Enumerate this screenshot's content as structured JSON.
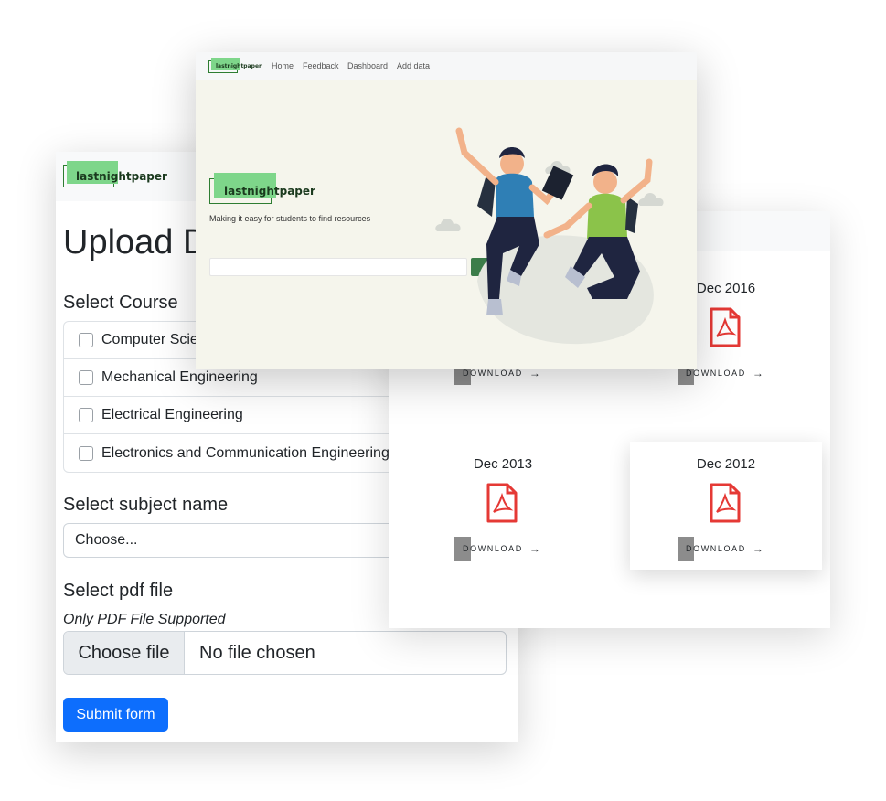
{
  "upload_window": {
    "logo_text": "lastnightpaper",
    "title": "Upload Data",
    "course_heading": "Select Course",
    "courses": [
      "Computer Science",
      "Mechanical Engineering",
      "Electrical Engineering",
      "Electronics and Communication Engineering"
    ],
    "subject_heading": "Select subject name",
    "subject_placeholder": "Choose...",
    "pdf_heading": "Select pdf file",
    "pdf_hint": "Only PDF File Supported",
    "file_button": "Choose file",
    "file_status": "No file chosen",
    "submit_label": "Submit form",
    "colors": {
      "primary": "#0d6efd",
      "logo": "#7ed68a"
    }
  },
  "home_window": {
    "logo_text": "lastnightpaper",
    "nav": [
      "Home",
      "Feedback",
      "Dashboard",
      "Add data"
    ],
    "hero_logo_text": "lastnightpaper",
    "tagline": "Making it easy for students to find resources",
    "search_button": "Search",
    "illustration": "two-jumping-students-illustration",
    "colors": {
      "search": "#3c7d4a",
      "background": "#f5f5ec"
    }
  },
  "papers_window": {
    "papers": [
      {
        "date": "",
        "icon": "pdf-icon",
        "download": "DOWNLOAD"
      },
      {
        "date": "Dec 2016",
        "icon": "pdf-icon",
        "download": "DOWNLOAD"
      },
      {
        "date": "Dec 2013",
        "icon": "pdf-icon",
        "download": "DOWNLOAD"
      },
      {
        "date": "Dec 2012",
        "icon": "pdf-icon",
        "download": "DOWNLOAD"
      }
    ],
    "arrow": "→",
    "colors": {
      "pdf": "#e53935"
    }
  }
}
